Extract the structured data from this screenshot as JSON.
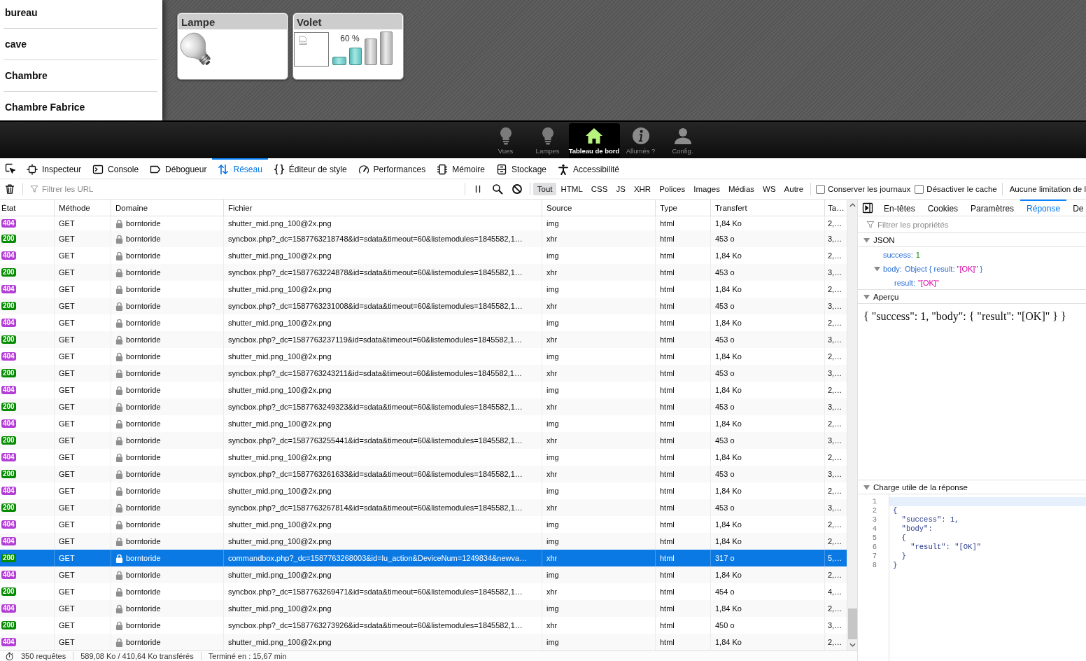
{
  "sidebar": {
    "items": [
      {
        "label": "bureau"
      },
      {
        "label": "cave"
      },
      {
        "label": "Chambre"
      },
      {
        "label": "Chambre Fabrice"
      }
    ]
  },
  "widgets": [
    {
      "kind": "lamp",
      "title": "Lampe"
    },
    {
      "kind": "shutter",
      "title": "Volet",
      "reading": "60 %",
      "bars": [
        {
          "on": true
        },
        {
          "on": true
        },
        {
          "on": false
        },
        {
          "on": false
        }
      ]
    }
  ],
  "nav_bar": {
    "items": [
      {
        "label": "Vues",
        "kind": "views",
        "selected": false
      },
      {
        "label": "Lampes",
        "kind": "lamps",
        "selected": false
      },
      {
        "label": "Tableau de bord",
        "kind": "dashboard",
        "selected": true
      },
      {
        "label": "Allumés ?",
        "kind": "lit",
        "selected": false
      },
      {
        "label": "Config.",
        "kind": "config",
        "selected": false
      }
    ]
  },
  "devtools_tabs": [
    {
      "label": "Inspecteur",
      "kind": "inspector",
      "selected": false
    },
    {
      "label": "Console",
      "kind": "console",
      "selected": false
    },
    {
      "label": "Débogueur",
      "kind": "debugger",
      "selected": false
    },
    {
      "label": "Réseau",
      "kind": "network",
      "selected": true
    },
    {
      "label": "Éditeur de style",
      "kind": "style",
      "selected": false
    },
    {
      "label": "Performances",
      "kind": "performance",
      "selected": false
    },
    {
      "label": "Mémoire",
      "kind": "memory",
      "selected": false
    },
    {
      "label": "Stockage",
      "kind": "storage",
      "selected": false
    },
    {
      "label": "Accessibilité",
      "kind": "accessibility",
      "selected": false
    }
  ],
  "toolbar": {
    "filter_field": {
      "placeholder": "Filtrer les URL"
    },
    "type_filters": [
      {
        "label": "Tout",
        "selected": true
      },
      {
        "label": "HTML",
        "selected": false
      },
      {
        "label": "CSS",
        "selected": false
      },
      {
        "label": "JS",
        "selected": false
      },
      {
        "label": "XHR",
        "selected": false
      },
      {
        "label": "Polices",
        "selected": false
      },
      {
        "label": "Images",
        "selected": false
      },
      {
        "label": "Médias",
        "selected": false
      },
      {
        "label": "WS",
        "selected": false
      },
      {
        "label": "Autre",
        "selected": false
      }
    ],
    "options": [
      {
        "label": "Conserver les journaux",
        "checked": false
      },
      {
        "label": "Désactiver le cache",
        "checked": false
      }
    ],
    "throttling": "Aucune limitation de l"
  },
  "table": {
    "columns": [
      "État",
      "Méthode",
      "Domaine",
      "Fichier",
      "Source",
      "Type",
      "Transfert",
      "Ta…"
    ],
    "rows": [
      {
        "color": "#b23ed6",
        "cells": [
          "404",
          "GET",
          "borntoride",
          "shutter_mid.png_100@2x.png",
          "img",
          "html",
          "1,84 Ko",
          "2,…"
        ],
        "selected": false
      },
      {
        "color": "#058b00",
        "cells": [
          "200",
          "GET",
          "borntoride",
          "syncbox.php?_dc=1587763218748&id=sdata&timeout=60&listemodules=1845582,1…",
          "xhr",
          "html",
          "453 o",
          "3,…"
        ],
        "selected": false
      },
      {
        "color": "#b23ed6",
        "cells": [
          "404",
          "GET",
          "borntoride",
          "shutter_mid.png_100@2x.png",
          "img",
          "html",
          "1,84 Ko",
          "2,…"
        ],
        "selected": false
      },
      {
        "color": "#058b00",
        "cells": [
          "200",
          "GET",
          "borntoride",
          "syncbox.php?_dc=1587763224878&id=sdata&timeout=60&listemodules=1845582,1…",
          "xhr",
          "html",
          "453 o",
          "3,…"
        ],
        "selected": false
      },
      {
        "color": "#b23ed6",
        "cells": [
          "404",
          "GET",
          "borntoride",
          "shutter_mid.png_100@2x.png",
          "img",
          "html",
          "1,84 Ko",
          "2,…"
        ],
        "selected": false
      },
      {
        "color": "#058b00",
        "cells": [
          "200",
          "GET",
          "borntoride",
          "syncbox.php?_dc=1587763231008&id=sdata&timeout=60&listemodules=1845582,1…",
          "xhr",
          "html",
          "453 o",
          "3,…"
        ],
        "selected": false
      },
      {
        "color": "#b23ed6",
        "cells": [
          "404",
          "GET",
          "borntoride",
          "shutter_mid.png_100@2x.png",
          "img",
          "html",
          "1,84 Ko",
          "2,…"
        ],
        "selected": false
      },
      {
        "color": "#058b00",
        "cells": [
          "200",
          "GET",
          "borntoride",
          "syncbox.php?_dc=1587763237119&id=sdata&timeout=60&listemodules=1845582,1…",
          "xhr",
          "html",
          "453 o",
          "3,…"
        ],
        "selected": false
      },
      {
        "color": "#b23ed6",
        "cells": [
          "404",
          "GET",
          "borntoride",
          "shutter_mid.png_100@2x.png",
          "img",
          "html",
          "1,84 Ko",
          "2,…"
        ],
        "selected": false
      },
      {
        "color": "#058b00",
        "cells": [
          "200",
          "GET",
          "borntoride",
          "syncbox.php?_dc=1587763243211&id=sdata&timeout=60&listemodules=1845582,1…",
          "xhr",
          "html",
          "453 o",
          "3,…"
        ],
        "selected": false
      },
      {
        "color": "#b23ed6",
        "cells": [
          "404",
          "GET",
          "borntoride",
          "shutter_mid.png_100@2x.png",
          "img",
          "html",
          "1,84 Ko",
          "2,…"
        ],
        "selected": false
      },
      {
        "color": "#058b00",
        "cells": [
          "200",
          "GET",
          "borntoride",
          "syncbox.php?_dc=1587763249323&id=sdata&timeout=60&listemodules=1845582,1…",
          "xhr",
          "html",
          "453 o",
          "3,…"
        ],
        "selected": false
      },
      {
        "color": "#b23ed6",
        "cells": [
          "404",
          "GET",
          "borntoride",
          "shutter_mid.png_100@2x.png",
          "img",
          "html",
          "1,84 Ko",
          "2,…"
        ],
        "selected": false
      },
      {
        "color": "#058b00",
        "cells": [
          "200",
          "GET",
          "borntoride",
          "syncbox.php?_dc=1587763255441&id=sdata&timeout=60&listemodules=1845582,1…",
          "xhr",
          "html",
          "453 o",
          "3,…"
        ],
        "selected": false
      },
      {
        "color": "#b23ed6",
        "cells": [
          "404",
          "GET",
          "borntoride",
          "shutter_mid.png_100@2x.png",
          "img",
          "html",
          "1,84 Ko",
          "2,…"
        ],
        "selected": false
      },
      {
        "color": "#058b00",
        "cells": [
          "200",
          "GET",
          "borntoride",
          "syncbox.php?_dc=1587763261633&id=sdata&timeout=60&listemodules=1845582,1…",
          "xhr",
          "html",
          "453 o",
          "3,…"
        ],
        "selected": false
      },
      {
        "color": "#b23ed6",
        "cells": [
          "404",
          "GET",
          "borntoride",
          "shutter_mid.png_100@2x.png",
          "img",
          "html",
          "1,84 Ko",
          "2,…"
        ],
        "selected": false
      },
      {
        "color": "#058b00",
        "cells": [
          "200",
          "GET",
          "borntoride",
          "syncbox.php?_dc=1587763267814&id=sdata&timeout=60&listemodules=1845582,1…",
          "xhr",
          "html",
          "453 o",
          "3,…"
        ],
        "selected": false
      },
      {
        "color": "#b23ed6",
        "cells": [
          "404",
          "GET",
          "borntoride",
          "shutter_mid.png_100@2x.png",
          "img",
          "html",
          "1,84 Ko",
          "2,…"
        ],
        "selected": false
      },
      {
        "color": "#b23ed6",
        "cells": [
          "404",
          "GET",
          "borntoride",
          "shutter_mid.png_100@2x.png",
          "img",
          "html",
          "1,84 Ko",
          "2,…"
        ],
        "selected": false
      },
      {
        "color": "#058b00",
        "cells": [
          "200",
          "GET",
          "borntoride",
          "commandbox.php?_dc=1587763268003&id=lu_action&DeviceNum=1249834&newva…",
          "xhr",
          "html",
          "317 o",
          "5,…"
        ],
        "selected": true
      },
      {
        "color": "#b23ed6",
        "cells": [
          "404",
          "GET",
          "borntoride",
          "shutter_mid.png_100@2x.png",
          "img",
          "html",
          "1,84 Ko",
          "2,…"
        ],
        "selected": false
      },
      {
        "color": "#058b00",
        "cells": [
          "200",
          "GET",
          "borntoride",
          "syncbox.php?_dc=1587763269471&id=sdata&timeout=60&listemodules=1845582,1…",
          "xhr",
          "html",
          "454 o",
          "4,…"
        ],
        "selected": false
      },
      {
        "color": "#b23ed6",
        "cells": [
          "404",
          "GET",
          "borntoride",
          "shutter_mid.png_100@2x.png",
          "img",
          "html",
          "1,84 Ko",
          "2,…"
        ],
        "selected": false
      },
      {
        "color": "#058b00",
        "cells": [
          "200",
          "GET",
          "borntoride",
          "syncbox.php?_dc=1587763273926&id=sdata&timeout=60&listemodules=1845582,1…",
          "xhr",
          "html",
          "450 o",
          "3,…"
        ],
        "selected": false
      },
      {
        "color": "#b23ed6",
        "cells": [
          "404",
          "GET",
          "borntoride",
          "shutter_mid.png_100@2x.png",
          "img",
          "html",
          "1,84 Ko",
          "2,…"
        ],
        "selected": false
      }
    ]
  },
  "status_bar": {
    "items": [
      "350 requêtes",
      "589,08 Ko / 410,64 Ko transférés",
      "Terminé en : 15,67 min"
    ]
  },
  "details": {
    "tabs": [
      {
        "label": "En-têtes",
        "selected": false
      },
      {
        "label": "Cookies",
        "selected": false
      },
      {
        "label": "Paramètres",
        "selected": false
      },
      {
        "label": "Réponse",
        "selected": true
      },
      {
        "label": "De",
        "selected": false
      }
    ],
    "filter_field": {
      "placeholder": "Filtrer les propriétés"
    },
    "sections": [
      {
        "kind": "tree",
        "title": "JSON",
        "expanded": true,
        "items": [
          {
            "key": "success:",
            "value": "1",
            "kind": "number"
          },
          {
            "key": "body:",
            "expanded": true,
            "value_parts": [
              {
                "text": "Object { result: ",
                "kind": "object"
              },
              {
                "text": "\"[OK]\"",
                "kind": "string"
              },
              {
                "text": " }",
                "kind": "object"
              }
            ],
            "children": [
              {
                "key": "result:",
                "value": "\"[OK]\"",
                "kind": "string"
              }
            ]
          }
        ]
      },
      {
        "kind": "preview",
        "title": "Aperçu",
        "expanded": true,
        "text": "{ \"success\": 1, \"body\": { \"result\": \"[OK]\" } }"
      },
      {
        "kind": "code",
        "title": "Charge utile de la réponse",
        "expanded": true,
        "lines": [
          {
            "number": "1",
            "active": true
          },
          {
            "number": "2",
            "text": "{",
            "active": false
          },
          {
            "number": "3",
            "text": "  \"success\": 1,",
            "active": false
          },
          {
            "number": "4",
            "text": "  \"body\":",
            "active": false
          },
          {
            "number": "5",
            "text": "  {",
            "active": false
          },
          {
            "number": "6",
            "text": "    \"result\": \"[OK]\"",
            "active": false
          },
          {
            "number": "7",
            "text": "  }",
            "active": false
          },
          {
            "number": "8",
            "text": "}",
            "active": false
          }
        ]
      }
    ]
  }
}
